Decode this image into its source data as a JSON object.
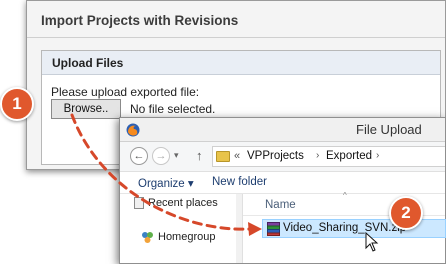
{
  "import_dialog": {
    "title": "Import Projects with Revisions",
    "panel_header": "Upload Files",
    "prompt": "Please upload exported file:",
    "browse_label": "Browse..",
    "file_status": "No file selected."
  },
  "file_upload": {
    "title": "File Upload",
    "nav_symbols": {
      "back": "←",
      "forward": "→",
      "dropdown": "▾",
      "up": "↑"
    },
    "path_prefix": "«",
    "path_separator": "›",
    "breadcrumbs": [
      "VPProjects",
      "Exported"
    ],
    "toolbar": {
      "organize": "Organize ▾",
      "new_folder": "New folder"
    },
    "nav_pane": [
      "Recent places",
      "Homegroup"
    ],
    "column_name": "Name",
    "sort_caret": "^",
    "files": [
      {
        "name": "Video_Sharing_SVN.zip",
        "selected": true
      }
    ]
  },
  "steps": [
    {
      "label": "1"
    },
    {
      "label": "2"
    }
  ],
  "colors": {
    "accent": "#e0582d",
    "selection": "#cce8ff",
    "link": "#1e3e70"
  },
  "icons": [
    "firefox-icon",
    "folder-icon",
    "recent-places-icon",
    "homegroup-icon",
    "zip-archive-icon",
    "mouse-pointer-icon"
  ]
}
